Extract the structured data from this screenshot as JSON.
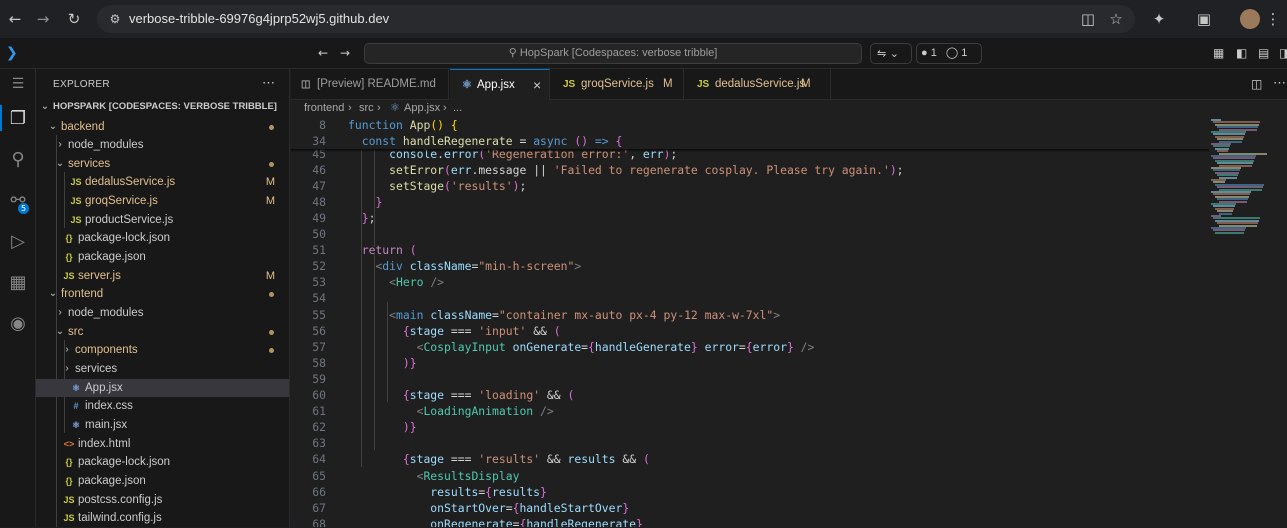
{
  "browser": {
    "url": "verbose-tribble-69976g4jprp52wj5.github.dev"
  },
  "titlebar": {
    "command_center": "HopSpark [Codespaces: verbose tribble]",
    "ports_count": "1",
    "sessions_count": "1"
  },
  "explorer": {
    "title": "EXPLORER",
    "root": "HOPSPARK [CODESPACES: VERBOSE TRIBBLE]",
    "items": [
      {
        "label": "backend",
        "badge": "",
        "kind": "folder-open"
      },
      {
        "label": "node_modules",
        "badge": "",
        "kind": "folder"
      },
      {
        "label": "services",
        "badge": "",
        "kind": "folder-open"
      },
      {
        "label": "dedalusService.js",
        "badge": "M",
        "kind": "js"
      },
      {
        "label": "groqService.js",
        "badge": "M",
        "kind": "js"
      },
      {
        "label": "productService.js",
        "badge": "",
        "kind": "js"
      },
      {
        "label": "package-lock.json",
        "badge": "",
        "kind": "json"
      },
      {
        "label": "package.json",
        "badge": "",
        "kind": "json"
      },
      {
        "label": "server.js",
        "badge": "M",
        "kind": "js"
      },
      {
        "label": "frontend",
        "badge": "",
        "kind": "folder-open"
      },
      {
        "label": "node_modules",
        "badge": "",
        "kind": "folder"
      },
      {
        "label": "src",
        "badge": "",
        "kind": "folder-open"
      },
      {
        "label": "components",
        "badge": "",
        "kind": "folder"
      },
      {
        "label": "services",
        "badge": "",
        "kind": "folder"
      },
      {
        "label": "App.jsx",
        "badge": "",
        "kind": "jsx"
      },
      {
        "label": "index.css",
        "badge": "",
        "kind": "css"
      },
      {
        "label": "main.jsx",
        "badge": "",
        "kind": "jsx"
      },
      {
        "label": "index.html",
        "badge": "",
        "kind": "html"
      },
      {
        "label": "package-lock.json",
        "badge": "",
        "kind": "json"
      },
      {
        "label": "package.json",
        "badge": "",
        "kind": "json"
      },
      {
        "label": "postcss.config.js",
        "badge": "",
        "kind": "js"
      },
      {
        "label": "tailwind.config.js",
        "badge": "",
        "kind": "js"
      }
    ]
  },
  "tabs": [
    {
      "label": "[Preview] README.md",
      "badge": ""
    },
    {
      "label": "App.jsx",
      "badge": ""
    },
    {
      "label": "groqService.js",
      "badge": "M"
    },
    {
      "label": "dedalusService.js",
      "badge": "M"
    }
  ],
  "breadcrumb": {
    "parts": [
      "frontend",
      "src",
      "App.jsx",
      "..."
    ]
  },
  "editor": {
    "sticky": [
      {
        "line": "8",
        "text": "function App() {"
      },
      {
        "line": "34",
        "text": "  const handleRegenerate = async () => {"
      }
    ],
    "lines": [
      {
        "line": "45",
        "text": "      console.error('Regeneration error:', err);"
      },
      {
        "line": "46",
        "text": "      setError(err.message || 'Failed to regenerate cosplay. Please try again.');"
      },
      {
        "line": "47",
        "text": "      setStage('results');"
      },
      {
        "line": "48",
        "text": "    }"
      },
      {
        "line": "49",
        "text": "  };"
      },
      {
        "line": "50",
        "text": ""
      },
      {
        "line": "51",
        "text": "  return ("
      },
      {
        "line": "52",
        "text": "    <div className=\"min-h-screen\">"
      },
      {
        "line": "53",
        "text": "      <Hero />"
      },
      {
        "line": "54",
        "text": ""
      },
      {
        "line": "55",
        "text": "      <main className=\"container mx-auto px-4 py-12 max-w-7xl\">"
      },
      {
        "line": "56",
        "text": "        {stage === 'input' && ("
      },
      {
        "line": "57",
        "text": "          <CosplayInput onGenerate={handleGenerate} error={error} />"
      },
      {
        "line": "58",
        "text": "        )}"
      },
      {
        "line": "59",
        "text": ""
      },
      {
        "line": "60",
        "text": "        {stage === 'loading' && ("
      },
      {
        "line": "61",
        "text": "          <LoadingAnimation />"
      },
      {
        "line": "62",
        "text": "        )}"
      },
      {
        "line": "63",
        "text": ""
      },
      {
        "line": "64",
        "text": "        {stage === 'results' && results && ("
      },
      {
        "line": "65",
        "text": "          <ResultsDisplay"
      },
      {
        "line": "66",
        "text": "            results={results}"
      },
      {
        "line": "67",
        "text": "            onStartOver={handleStartOver}"
      },
      {
        "line": "68",
        "text": "            onRegenerate={handleRegenerate}"
      }
    ]
  },
  "colors": {
    "accent": "#0078d4",
    "modified": "#e2c08d",
    "folder_dot": "#b3925c"
  }
}
